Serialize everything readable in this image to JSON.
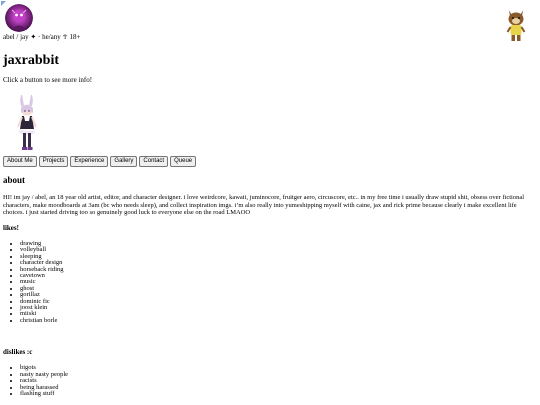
{
  "profile": {
    "tagline": "abel / jay ✦ · he/any ☥ 18+",
    "title": "jaxrabbit",
    "hint": "Click a button to see more info!"
  },
  "nav": {
    "buttons": [
      "About Me",
      "Projects",
      "Experience",
      "Gallery",
      "Contact",
      "Queue"
    ]
  },
  "about": {
    "heading": "about",
    "text": "HI! im jay / abel, an 18 year old artist, editor, and character designer. i love weirdcore, kawaii, juminocore, fruitger aero, circuscore, etc.. in my free time i usually draw stupid shit, obsess over fictional characters, make moodboards at 3am (bc who needs sleep), and collect inspiration imgs. i’m also really into yumeshipping myself with caine, jax and rick prime because clearly i make excellent life choices. i just started driving too so genuinely good luck to everyone else on the road LMAOO"
  },
  "likes": {
    "heading": "likes!",
    "items": [
      "drawing",
      "volleyball",
      "sleeping",
      "character design",
      "horseback riding",
      "cavetown",
      "music",
      "ghost",
      "gorillaz",
      "dominic fic",
      "joost klein",
      "miiski",
      "christian borle"
    ]
  },
  "dislikes": {
    "heading": "dislikes :c",
    "items": [
      "bigots",
      "nasty nasty people",
      "racists",
      "being harassed",
      "flashing stuff"
    ]
  },
  "icons": {
    "corner": "link-icon",
    "avatar": "avatar-image",
    "sticker": "animal-sticker-icon",
    "character": "bunny-character-image"
  },
  "colors": {
    "avatar_bg": "#3a0d3f",
    "avatar_accent": "#c23fc8",
    "character_hair": "#d8c6e6",
    "character_dress": "#2c2438",
    "sticker_body": "#8a5a2b",
    "sticker_shirt": "#e8d44a"
  }
}
